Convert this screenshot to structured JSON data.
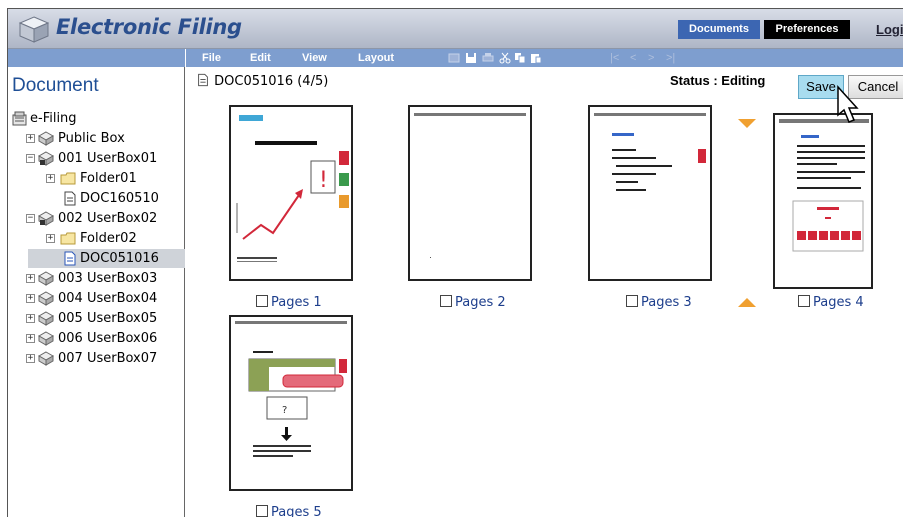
{
  "app": {
    "title": "Electronic Filing"
  },
  "header": {
    "tabs": {
      "documents": "Documents",
      "preferences": "Preferences"
    },
    "login": "Logi"
  },
  "sidebar": {
    "title": "Document",
    "tree": [
      {
        "label": "e-Filing",
        "icon": "efiling-root-icon"
      },
      {
        "label": "Public Box",
        "icon": "public-box-icon"
      },
      {
        "label": "001 UserBox01",
        "icon": "locked-userbox-icon"
      },
      {
        "label": "Folder01",
        "icon": "folder-icon"
      },
      {
        "label": "DOC160510",
        "icon": "document-icon"
      },
      {
        "label": "002 UserBox02",
        "icon": "locked-userbox-icon"
      },
      {
        "label": "Folder02",
        "icon": "folder-icon"
      },
      {
        "label": "DOC051016",
        "icon": "document-icon"
      },
      {
        "label": "003 UserBox03",
        "icon": "userbox-icon"
      },
      {
        "label": "004 UserBox04",
        "icon": "userbox-icon"
      },
      {
        "label": "005 UserBox05",
        "icon": "userbox-icon"
      },
      {
        "label": "006 UserBox06",
        "icon": "userbox-icon"
      },
      {
        "label": "007 UserBox07",
        "icon": "userbox-icon"
      }
    ]
  },
  "menubar": {
    "items": [
      "File",
      "Edit",
      "View",
      "Layout"
    ],
    "icons": [
      "scan-icon",
      "save-icon",
      "print-icon",
      "cut-icon",
      "copy-icon",
      "paste-icon"
    ],
    "nav": [
      "first-page-icon",
      "previous-page-icon",
      "next-page-icon",
      "last-page-icon"
    ]
  },
  "main": {
    "document_title": "DOC051016",
    "document_count": "(4/5)",
    "status": "Status : Editing",
    "save_label": "Save",
    "cancel_label": "Cancel",
    "pages": [
      {
        "label": "Pages 1"
      },
      {
        "label": "Pages 2"
      },
      {
        "label": "Pages 3"
      },
      {
        "label": "Pages 4"
      },
      {
        "label": "Pages 5"
      }
    ]
  },
  "colors": {
    "accent_blue": "#2b4f8e",
    "menubar": "#7e9ecf",
    "documents_tab": "#3c66b2",
    "save_button": "#a8dcef",
    "move_arrow": "#f0a030"
  }
}
